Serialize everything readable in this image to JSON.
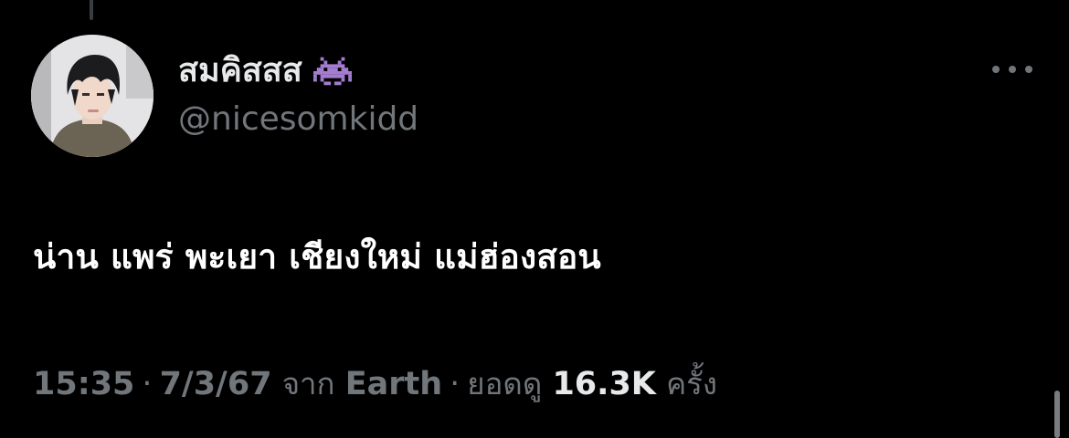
{
  "author": {
    "display_name": "สมคิสสส",
    "handle": "@nicesomkidd",
    "emoji_icon": "alien-monster-icon"
  },
  "tweet": {
    "text": "น่าน แพร่ พะเยา เชียงใหม่ แม่ฮ่องสอน"
  },
  "meta": {
    "time": "15:35",
    "separator": "·",
    "date": "7/3/67",
    "via_label": "จาก",
    "source": "Earth",
    "views_label": "ยอดดู",
    "views_count": "16.3K",
    "views_suffix": "ครั้ง"
  },
  "colors": {
    "background": "#000000",
    "primary_text": "#e7e9ea",
    "secondary_text": "#71767b",
    "emoji_purple": "#a47cd0"
  },
  "icons": {
    "more": "more-horizontal-icon"
  }
}
